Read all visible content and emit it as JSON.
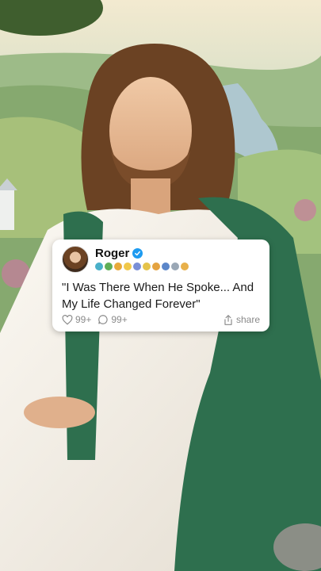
{
  "post": {
    "author_name": "Roger",
    "verified_icon": "verified-check-icon",
    "badge_icons": [
      "badge-1-icon",
      "badge-2-icon",
      "badge-3-icon",
      "badge-4-icon",
      "badge-5-icon",
      "badge-6-icon",
      "badge-7-icon",
      "badge-8-icon",
      "badge-9-icon",
      "badge-10-icon"
    ],
    "text": "\"I Was There When He Spoke... And My Life Changed Forever\"",
    "like_count": "99+",
    "comment_count": "99+",
    "share_label": "share"
  },
  "colors": {
    "verified": "#1d9bf0",
    "action_text": "#8a8a8a",
    "robe_green": "#2e6f4e"
  }
}
